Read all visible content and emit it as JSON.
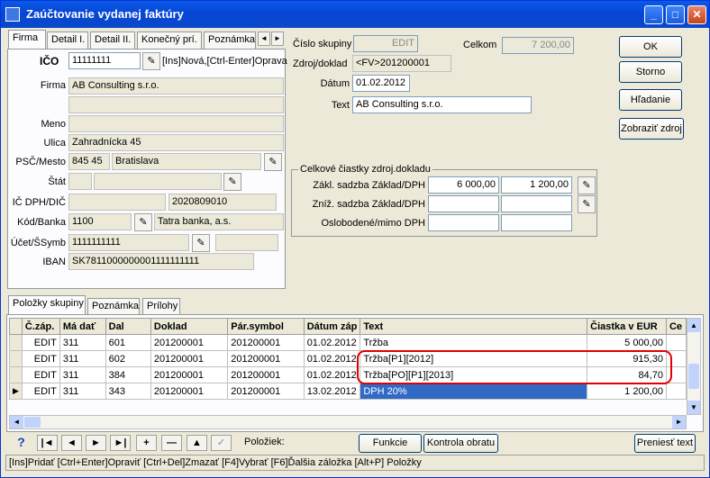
{
  "window": {
    "title": "Zaúčtovanie vydanej faktúry",
    "minimize": "_",
    "maximize": "□",
    "close": "✕"
  },
  "tabs": [
    "Firma",
    "Detail I.",
    "Detail II.",
    "Konečný prí.",
    "Poznámka"
  ],
  "tab_scroll": {
    "left": "◄",
    "right": "►"
  },
  "firma": {
    "ico_label": "IČO",
    "ico_value": "11111111",
    "ico_hint": "[Ins]Nová,[Ctrl-Enter]Oprava",
    "firma_label": "Firma",
    "firma_value": "AB Consulting s.r.o.",
    "meno_label": "Meno",
    "meno_value": "",
    "ulica_label": "Ulica",
    "ulica_value": "Zahradnícka 45",
    "psc_label": "PSČ/Mesto",
    "psc_value": "845 45",
    "mesto_value": "Bratislava",
    "stat_label": "Štát",
    "icdph_label": "IČ DPH/DIČ",
    "dic_value": "2020809010",
    "kod_label": "Kód/Banka",
    "kod_value": "1100",
    "banka_value": "Tatra banka, a.s.",
    "ucet_label": "Účet/ŠSymb",
    "ucet_value": "1111111111",
    "iban_label": "IBAN",
    "iban_value": "SK7811000000001111111111"
  },
  "header": {
    "cislo_skupiny_label": "Číslo skupiny",
    "cislo_skupiny_value": "EDIT",
    "celkom_label": "Celkom",
    "celkom_value": "7 200,00",
    "zdroj_label": "Zdroj/doklad",
    "zdroj_value": "<FV>201200001",
    "datum_label": "Dátum",
    "datum_value": "01.02.2012",
    "text_label": "Text",
    "text_value": "AB Consulting s.r.o."
  },
  "buttons": {
    "ok": "OK",
    "storno": "Storno",
    "hladanie": "Hľadanie",
    "zobrazit": "Zobraziť zdroj"
  },
  "totals": {
    "group_title": "Celkové čiastky zdroj.dokladu",
    "zakl_label": "Zákl. sadzba Základ/DPH",
    "zakl_zaklad": "6 000,00",
    "zakl_dph": "1 200,00",
    "zniz_label": "Zníž. sadzba Základ/DPH",
    "oslob_label": "Oslobodené/mimo DPH"
  },
  "bottom_tabs": [
    "Položky skupiny",
    "Poznámka",
    "Prílohy"
  ],
  "grid": {
    "columns": [
      "Č.záp.",
      "Má dať",
      "Dal",
      "Doklad",
      "Pár.symbol",
      "Dátum záp",
      "Text",
      "Čiastka v EUR",
      "Ce"
    ],
    "rows": [
      {
        "cislo": "EDIT",
        "ma_dat": "311",
        "dal": "601",
        "doklad": "201200001",
        "par": "201200001",
        "datum": "01.02.2012",
        "text": "Tržba",
        "ciastka": "5 000,00"
      },
      {
        "cislo": "EDIT",
        "ma_dat": "311",
        "dal": "602",
        "doklad": "201200001",
        "par": "201200001",
        "datum": "01.02.2012",
        "text": "Tržba[P1][2012]",
        "ciastka": "915,30"
      },
      {
        "cislo": "EDIT",
        "ma_dat": "311",
        "dal": "384",
        "doklad": "201200001",
        "par": "201200001",
        "datum": "01.02.2012",
        "text": "Tržba[PO][P1][2013]",
        "ciastka": "84,70"
      },
      {
        "cislo": "EDIT",
        "ma_dat": "311",
        "dal": "343",
        "doklad": "201200001",
        "par": "201200001",
        "datum": "13.02.2012",
        "text": "DPH 20%",
        "ciastka": "1 200,00"
      }
    ]
  },
  "toolbar": {
    "help": "?",
    "first": "|◄",
    "prev": "◄",
    "next": "►",
    "last": "►|",
    "add": "+",
    "remove": "—",
    "up": "▲",
    "check": "✓",
    "poloziek_label": "Položiek:",
    "funkcie": "Funkcie",
    "kontrola": "Kontrola obratu",
    "preniest": "Preniesť text"
  },
  "status": "[Ins]Pridať [Ctrl+Enter]Opraviť [Ctrl+Del]Zmazať [F4]Vybrať [F6]Ďalšia záložka [Alt+P] Položky",
  "colors": {
    "highlight": "#316ac5",
    "annotation": "#e00000",
    "title_bar": "#0a5ae8"
  }
}
